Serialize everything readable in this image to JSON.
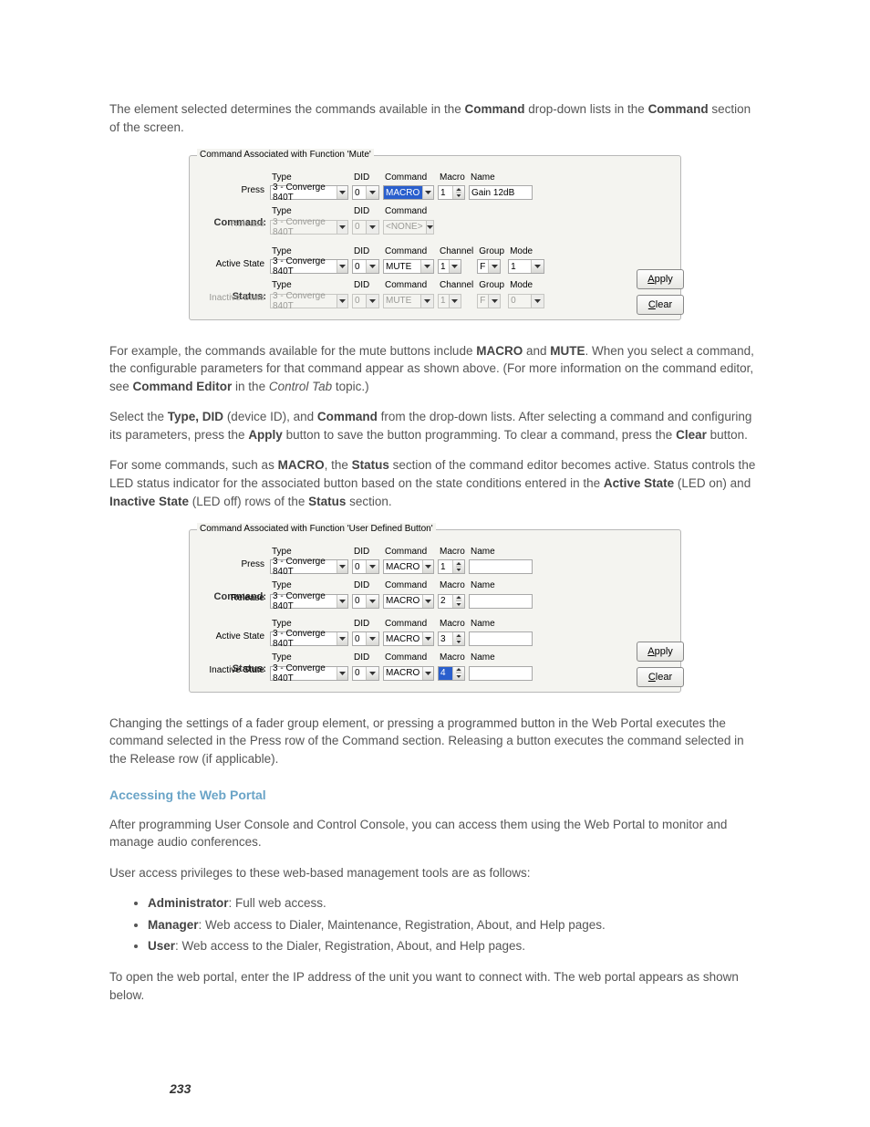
{
  "intro": {
    "p1_a": "The element selected determines the commands available in the ",
    "p1_b": "Command",
    "p1_c": " drop-down lists in the ",
    "p1_d": "Command",
    "p1_e": " section of the screen."
  },
  "panel1": {
    "legend": "Command Associated with Function 'Mute'",
    "headers": {
      "type": "Type",
      "did": "DID",
      "command": "Command",
      "channel": "Channel",
      "group": "Group",
      "mode": "Mode",
      "macro": "Macro",
      "name": "Name"
    },
    "side": {
      "command": "Command:",
      "status": "Status:"
    },
    "rows": {
      "press": {
        "label": "Press",
        "type": "3 - Converge 840T",
        "did": "0",
        "command": "MACRO",
        "command_hi": true,
        "macro": "1",
        "name": "Gain 12dB"
      },
      "release": {
        "label": "Release",
        "type": "3 - Converge 840T",
        "did": "0",
        "command": "<NONE>",
        "disabled": true
      },
      "active": {
        "label": "Active State",
        "type": "3 - Converge 840T",
        "did": "0",
        "command": "MUTE",
        "channel": "1",
        "group": "F",
        "mode": "1"
      },
      "inactive": {
        "label": "Inactive State",
        "type": "3 - Converge 840T",
        "did": "0",
        "command": "MUTE",
        "channel": "1",
        "group": "F",
        "mode": "0",
        "disabled": true
      }
    },
    "buttons": {
      "apply": "Apply",
      "clear": "Clear"
    }
  },
  "between1": {
    "p2_a": "For example, the commands available for the mute buttons include ",
    "p2_b": "MACRO",
    "p2_c": " and ",
    "p2_d": "MUTE",
    "p2_e": ". When you select a command, the configurable parameters for that command appear as shown above. (For more information on the command editor, see ",
    "p2_f": "Command Editor",
    "p2_g": " in the ",
    "p2_h": "Control Tab",
    "p2_i": " topic.)",
    "p3_a": "Select the ",
    "p3_b": "Type, DID",
    "p3_c": " (device ID), and ",
    "p3_d": "Command",
    "p3_e": " from the drop-down lists. After selecting a command and configuring its parameters, press the ",
    "p3_f": "Apply",
    "p3_g": " button to save the button programming. To clear a command, press the ",
    "p3_h": "Clear",
    "p3_i": " button.",
    "p4_a": "For some commands, such as ",
    "p4_b": "MACRO",
    "p4_c": ", the ",
    "p4_d": "Status",
    "p4_e": " section of the command editor becomes active. Status controls the LED status indicator for the associated button based on the state conditions entered in the ",
    "p4_f": "Active State",
    "p4_g": " (LED on) and ",
    "p4_h": "Inactive State",
    "p4_i": " (LED off) rows of the ",
    "p4_j": "Status",
    "p4_k": " section."
  },
  "panel2": {
    "legend": "Command Associated with Function 'User Defined Button'",
    "headers": {
      "type": "Type",
      "did": "DID",
      "command": "Command",
      "macro": "Macro",
      "name": "Name"
    },
    "side": {
      "command": "Command:",
      "status": "Status:"
    },
    "rows": {
      "press": {
        "label": "Press",
        "type": "3 - Converge 840T",
        "did": "0",
        "command": "MACRO",
        "macro": "1",
        "name": ""
      },
      "release": {
        "label": "Release",
        "type": "3 - Converge 840T",
        "did": "0",
        "command": "MACRO",
        "macro": "2",
        "name": ""
      },
      "active": {
        "label": "Active State",
        "type": "3 - Converge 840T",
        "did": "0",
        "command": "MACRO",
        "macro": "3",
        "name": ""
      },
      "inactive": {
        "label": "Inactive State",
        "type": "3 - Converge 840T",
        "did": "0",
        "command": "MACRO",
        "macro": "4",
        "name": "",
        "macro_hi": true
      }
    },
    "buttons": {
      "apply": "Apply",
      "clear": "Clear"
    }
  },
  "between2": {
    "p5": "Changing the settings of a fader group element, or pressing a programmed button in the Web Portal executes the command selected in the Press row of the Command section. Releasing a button executes the command selected in the Release row (if applicable).",
    "heading": "Accessing the Web Portal",
    "p6": "After programming User Console and Control Console, you can access them using the Web Portal to monitor and manage audio conferences.",
    "p7": "User access privileges to these web-based management tools are as follows:",
    "bullets": [
      {
        "b": "Administrator",
        "t": ": Full web access."
      },
      {
        "b": "Manager",
        "t": ": Web access to Dialer, Maintenance, Registration, About, and Help pages."
      },
      {
        "b": "User",
        "t": ": Web access to the Dialer, Registration, About, and Help pages."
      }
    ],
    "p8": "To open the web portal, enter the IP address of the unit you want to connect with. The web portal appears as shown below."
  },
  "pagenum": "233"
}
